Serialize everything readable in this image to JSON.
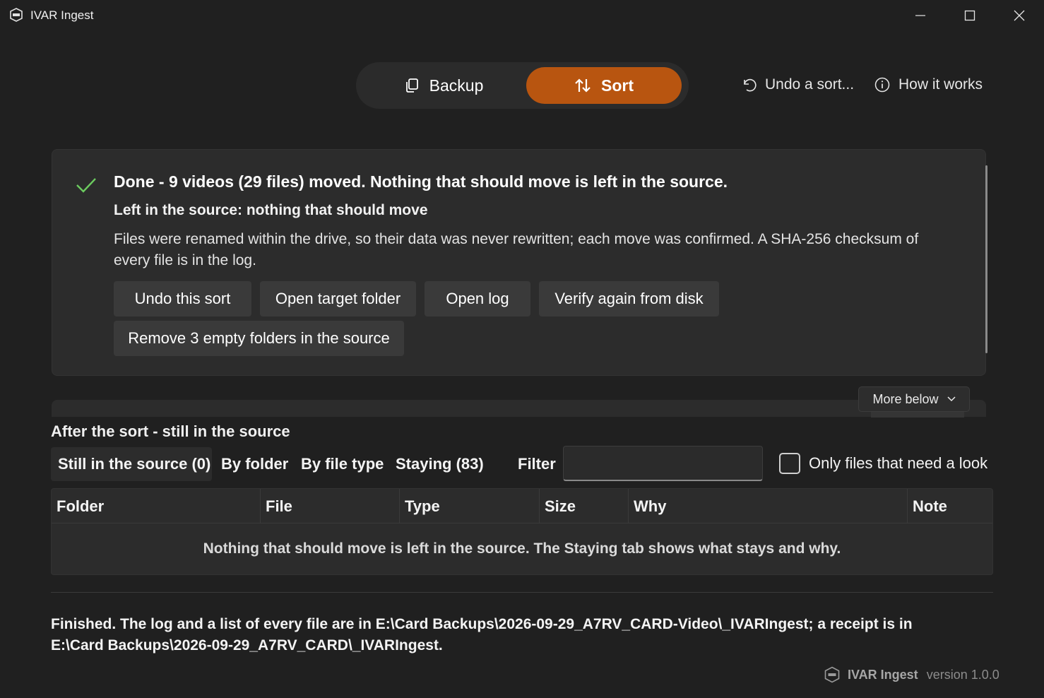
{
  "window": {
    "title": "IVAR Ingest",
    "icon": "ivar-logo-icon",
    "controls": [
      "minimize-icon",
      "maximize-icon",
      "close-icon"
    ]
  },
  "modes": {
    "backup_label": "Backup",
    "sort_label": "Sort",
    "active": "Sort",
    "accent_color": "#b85510"
  },
  "top_links": {
    "undo_label": "Undo a sort...",
    "how_label": "How it works"
  },
  "result": {
    "title": "Done - 9 videos (29 files) moved. Nothing that should move is left in the source.",
    "subtitle": "Left in the source: nothing that should move",
    "body": "Files were renamed within the drive, so their data was never rewritten; each move was confirmed. A SHA-256 checksum of every file is in the log.",
    "status_color": "#6ccb5f",
    "buttons": {
      "undo": "Undo this sort",
      "open_target": "Open target folder",
      "open_log": "Open log",
      "verify": "Verify again from disk",
      "remove_empty": "Remove 3 empty folders in the source"
    }
  },
  "more_below_label": "More below",
  "after_sort": {
    "title": "After the sort - still in the source",
    "tabs": [
      "Still in the source (0)",
      "By folder",
      "By file type",
      "Staying (83)"
    ],
    "active_tab": "Still in the source (0)",
    "filter_label": "Filter",
    "filter_value": "",
    "only_need_look_label": "Only files that need a look",
    "only_need_look_checked": false
  },
  "table": {
    "columns": [
      "Folder",
      "File",
      "Type",
      "Size",
      "Why",
      "Note"
    ],
    "rows": [],
    "empty_message": "Nothing that should move is left in the source. The Staying tab shows what stays and why."
  },
  "footer": {
    "message": "Finished. The log and a list of every file are in E:\\Card Backups\\2026-09-29_A7RV_CARD-Video\\_IVARIngest; a receipt is in E:\\Card Backups\\2026-09-29_A7RV_CARD\\_IVARIngest.",
    "brand_name": "IVAR Ingest",
    "version": "version 1.0.0"
  }
}
